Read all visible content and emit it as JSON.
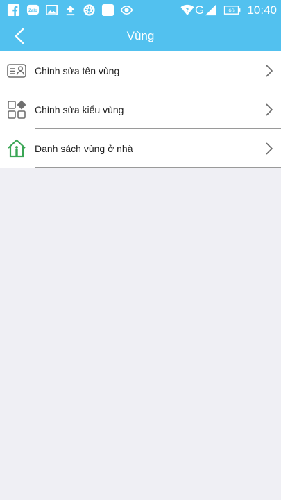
{
  "status_bar": {
    "time": "10:40",
    "battery": "66",
    "network": "G",
    "notifications": [
      "facebook-icon",
      "zalo-icon",
      "image-icon",
      "upload-icon",
      "settings-gear-icon",
      "blank-app-icon",
      "camera-icon"
    ]
  },
  "header": {
    "title": "Vùng",
    "back_icon": "chevron-left-icon"
  },
  "menu": {
    "items": [
      {
        "label": "Chỉnh sửa tên vùng",
        "icon": "id-card-icon"
      },
      {
        "label": "Chỉnh sửa kiểu vùng",
        "icon": "grid-shapes-icon"
      },
      {
        "label": "Danh sách vùng ở nhà",
        "icon": "home-icon"
      }
    ]
  },
  "colors": {
    "primary": "#52c1ef",
    "background": "#efeff4",
    "home_icon": "#3aa655",
    "icon_gray": "#6f6f6f"
  },
  "zalo_label": "Zalo"
}
